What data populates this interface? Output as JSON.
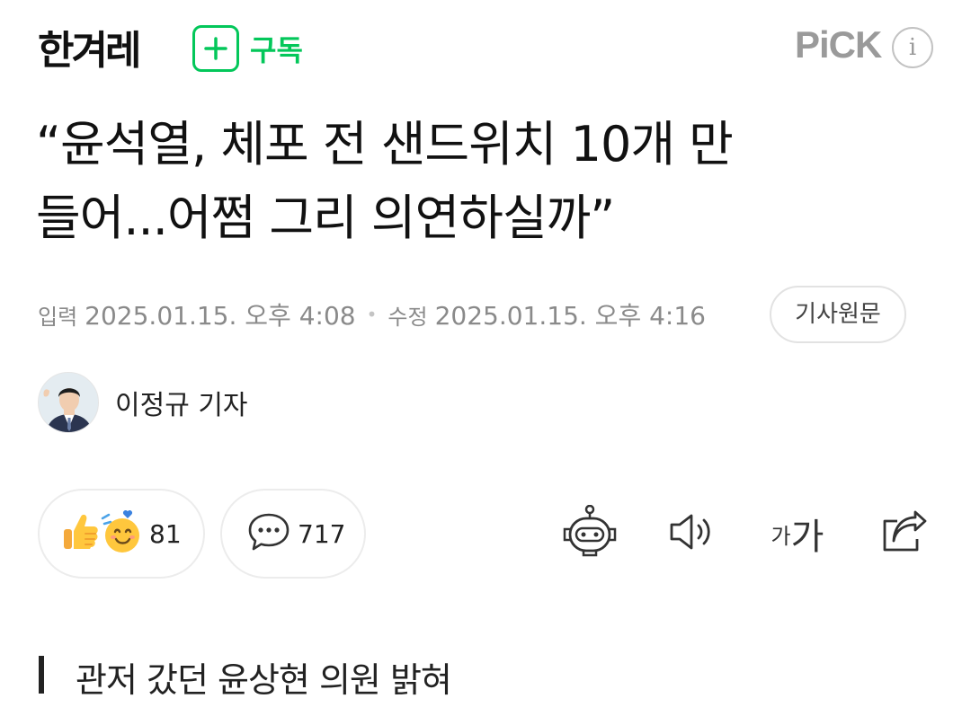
{
  "header": {
    "press_name": "한겨레",
    "subscribe_label": "구독",
    "pick_label": "PiCK",
    "info_icon": "i"
  },
  "article": {
    "title_line1": "“윤석열, 체포 전 샌드위치 10개 만",
    "title_line2": "들어...어쩜 그리 의연하실까”",
    "published_label": "입력",
    "published": "2025.01.15. 오후 4:08",
    "modified_label": "수정",
    "modified": "2025.01.15. 오후 4:16",
    "original_button": "기사원문",
    "reporter": "이정규 기자",
    "subheading": "관저 갔던 윤상현 의원 밝혀"
  },
  "actions": {
    "reaction_count": "81",
    "comment_count": "717",
    "font_small": "가",
    "font_big": "가"
  },
  "icons": [
    "plus-icon",
    "info-icon",
    "thumbs-up-icon",
    "smile-face-icon",
    "speech-bubble-icon",
    "robot-icon",
    "speaker-icon",
    "share-icon"
  ],
  "colors": {
    "accent": "#03c75a",
    "text": "#111111",
    "muted": "#8a8a8a",
    "border": "#ececec"
  }
}
